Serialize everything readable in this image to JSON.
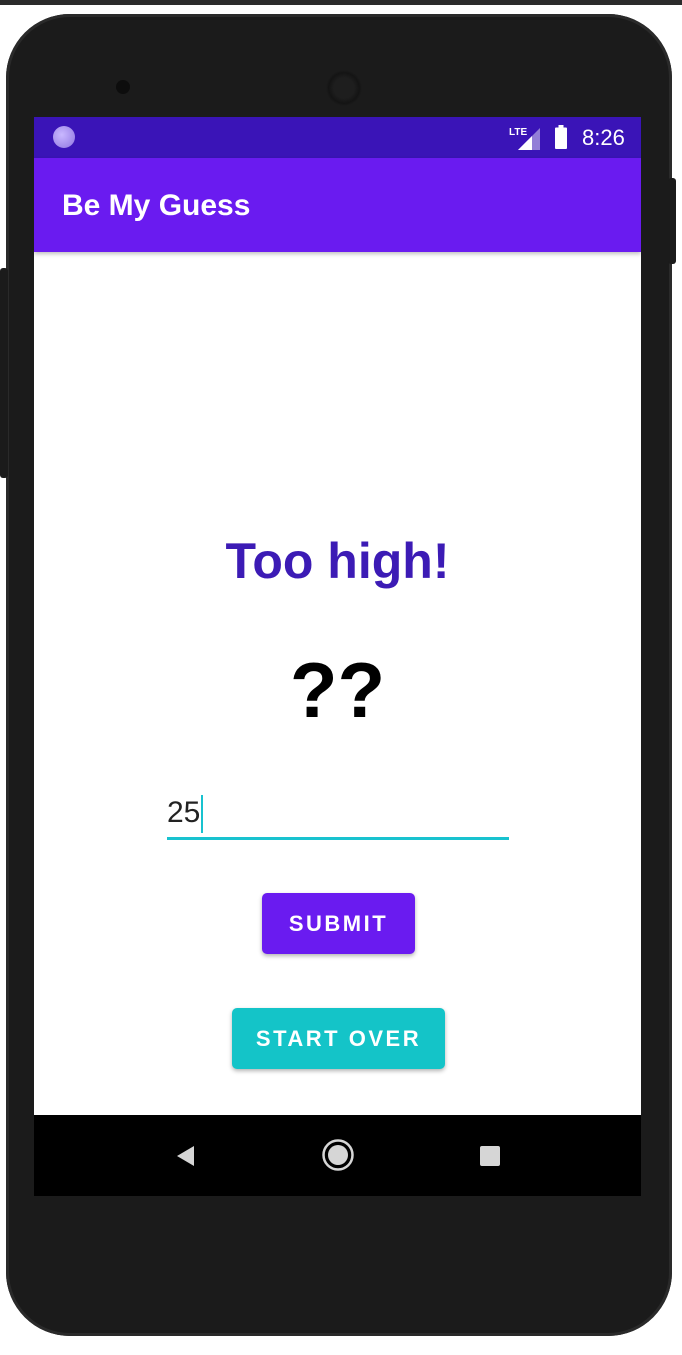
{
  "status_bar": {
    "network": "LTE",
    "time": "8:26"
  },
  "app_bar": {
    "title": "Be My Guess"
  },
  "game": {
    "feedback": "Too high!",
    "secret_number": "??",
    "guess_value": "25"
  },
  "buttons": {
    "submit_label": "SUBMIT",
    "start_over_label": "START OVER"
  },
  "colors": {
    "status_bar": "#3a14b7",
    "app_bar": "#6a1bf0",
    "feedback_text": "#3c1bb5",
    "accent": "#18c2cf",
    "start_over": "#14c4c8"
  },
  "icons": {
    "status": [
      "notification-dot-icon",
      "lte-signal-icon",
      "battery-icon"
    ],
    "navigation": [
      "back-icon",
      "home-icon",
      "recents-icon"
    ]
  }
}
